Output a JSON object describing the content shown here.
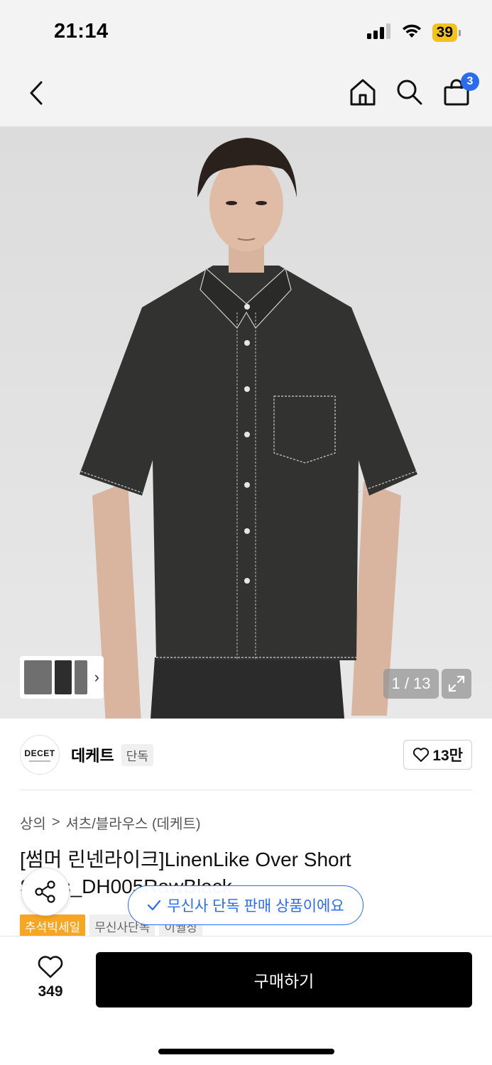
{
  "status_bar": {
    "time": "21:14",
    "battery": "39",
    "icons": [
      "cellular-signal-icon",
      "wifi-icon",
      "battery-icon"
    ]
  },
  "nav": {
    "icons": [
      "back-chevron-icon",
      "home-icon",
      "search-icon",
      "shopping-bag-icon"
    ],
    "cart_count": "3"
  },
  "gallery": {
    "counter": "1 / 13",
    "thumbnail_chevron": "›",
    "icons": [
      "expand-icon"
    ]
  },
  "brand": {
    "logo_text": "DECET",
    "name": "데케트",
    "exclusive_label": "단독",
    "likes": "13만"
  },
  "breadcrumb": {
    "category": "상의",
    "separator": ">",
    "subcategory": "셔츠/블라우스 (데케트)"
  },
  "product": {
    "title": "[썸머 린넨라이크]LinenLike Over Short Shirts_DH005RawBlack"
  },
  "tags": [
    "추석빅세일",
    "무신사단독",
    "이월상"
  ],
  "toast": {
    "text": "무신사 단독 판매 상품이에요"
  },
  "bottom_bar": {
    "wish_count": "349",
    "buy_label": "구매하기"
  },
  "colors": {
    "accent": "#2a6bf2",
    "sale_tag": "#f6a623",
    "battery": "#f4c21a",
    "buy_button": "#000000"
  }
}
